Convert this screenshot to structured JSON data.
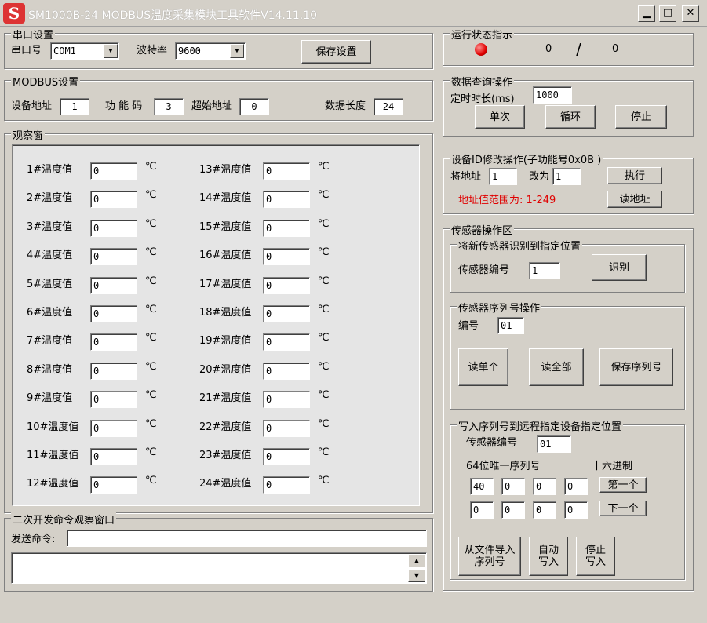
{
  "window": {
    "title": "SM1000B-24 MODBUS温度采集模块工具软件V14.11.10",
    "icon_letter": "S",
    "minimize": "▁",
    "maximize": "□",
    "close": "✕"
  },
  "serial": {
    "group_title": "串口设置",
    "port_label": "串口号",
    "port_value": "COM1",
    "baud_label": "波特率",
    "baud_value": "9600",
    "save_button": "保存设置"
  },
  "modbus": {
    "group_title": "MODBUS设置",
    "device_addr_label": "设备地址",
    "device_addr_value": "1",
    "func_code_label": "功 能 码",
    "func_code_value": "3",
    "start_addr_label": "超始地址",
    "start_addr_value": "0",
    "data_len_label": "数据长度",
    "data_len_value": "24"
  },
  "observe": {
    "group_title": "观察窗",
    "unit": "℃",
    "left_channels": [
      {
        "label": "1#温度值",
        "value": "0"
      },
      {
        "label": "2#温度值",
        "value": "0"
      },
      {
        "label": "3#温度值",
        "value": "0"
      },
      {
        "label": "4#温度值",
        "value": "0"
      },
      {
        "label": "5#温度值",
        "value": "0"
      },
      {
        "label": "6#温度值",
        "value": "0"
      },
      {
        "label": "7#温度值",
        "value": "0"
      },
      {
        "label": "8#温度值",
        "value": "0"
      },
      {
        "label": "9#温度值",
        "value": "0"
      },
      {
        "label": "10#温度值",
        "value": "0"
      },
      {
        "label": "11#温度值",
        "value": "0"
      },
      {
        "label": "12#温度值",
        "value": "0"
      }
    ],
    "right_channels": [
      {
        "label": "13#温度值",
        "value": "0"
      },
      {
        "label": "14#温度值",
        "value": "0"
      },
      {
        "label": "15#温度值",
        "value": "0"
      },
      {
        "label": "16#温度值",
        "value": "0"
      },
      {
        "label": "17#温度值",
        "value": "0"
      },
      {
        "label": "18#温度值",
        "value": "0"
      },
      {
        "label": "19#温度值",
        "value": "0"
      },
      {
        "label": "20#温度值",
        "value": "0"
      },
      {
        "label": "21#温度值",
        "value": "0"
      },
      {
        "label": "22#温度值",
        "value": "0"
      },
      {
        "label": "23#温度值",
        "value": "0"
      },
      {
        "label": "24#温度值",
        "value": "0"
      }
    ]
  },
  "dev_cmd": {
    "group_title": "二次开发命令观察窗口",
    "send_label": "发送命令:",
    "send_value": "",
    "log_value": ""
  },
  "status": {
    "group_title": "运行状态指示",
    "led_color": "#e00000",
    "count_left": "0",
    "separator": "/",
    "count_right": "0"
  },
  "query": {
    "group_title": "数据查询操作",
    "interval_label": "定时时长(ms)",
    "interval_value": "1000",
    "single_button": "单次",
    "loop_button": "循环",
    "stop_button": "停止"
  },
  "device_id": {
    "group_title": "设备ID修改操作(子功能号0x0B )",
    "addr_label": "将地址",
    "addr_value": "1",
    "change_to_label": "改为",
    "change_to_value": "1",
    "execute_button": "执行",
    "range_note": "地址值范围为: 1-249",
    "read_addr_button": "读地址"
  },
  "sensor": {
    "group_title": "传感器操作区",
    "identify": {
      "group_title": "将新传感器识别到指定位置",
      "sensor_no_label": "传感器编号",
      "sensor_no_value": "1",
      "identify_button": "识别"
    },
    "serial_op": {
      "group_title": "传感器序列号操作",
      "no_label": "编号",
      "no_value": "01",
      "read_one_button": "读单个",
      "read_all_button": "读全部",
      "save_serial_button": "保存序列号"
    },
    "write_remote": {
      "group_title": "写入序列号到远程指定设备指定位置",
      "sensor_no_label": "传感器编号",
      "sensor_no_value": "01",
      "uid_label": "64位唯一序列号",
      "hex_label": "十六进制",
      "row1": [
        "40",
        "0",
        "0",
        "0"
      ],
      "row2": [
        "0",
        "0",
        "0",
        "0"
      ],
      "first_button": "第一个",
      "next_button": "下一个",
      "import_button_l1": "从文件导入",
      "import_button_l2": "序列号",
      "auto_write_l1": "自动",
      "auto_write_l2": "写入",
      "stop_write_l1": "停止",
      "stop_write_l2": "写入"
    }
  }
}
